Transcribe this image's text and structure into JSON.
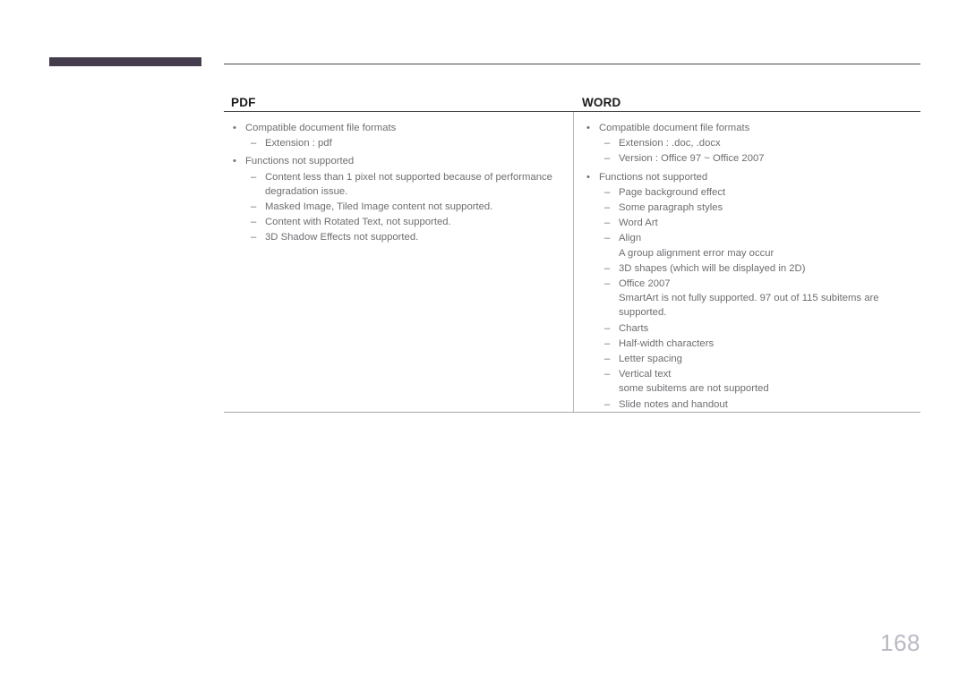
{
  "page": {
    "number": "168"
  },
  "columns": [
    {
      "header": "PDF",
      "items": [
        {
          "level": 1,
          "marker": "•",
          "text": "Compatible document file formats"
        },
        {
          "level": 2,
          "marker": "–",
          "text": "Extension : pdf"
        },
        {
          "level": 1,
          "marker": "•",
          "text": "Functions not supported"
        },
        {
          "level": 2,
          "marker": "–",
          "text": "Content less than 1 pixel not supported because of performance degradation issue."
        },
        {
          "level": 2,
          "marker": "–",
          "text": "Masked Image, Tiled Image content not supported."
        },
        {
          "level": 2,
          "marker": "–",
          "text": "Content with Rotated Text, not supported."
        },
        {
          "level": 2,
          "marker": "–",
          "text": "3D Shadow Effects not supported."
        }
      ]
    },
    {
      "header": "WORD",
      "items": [
        {
          "level": 1,
          "marker": "•",
          "text": "Compatible document file formats"
        },
        {
          "level": 2,
          "marker": "–",
          "text": "Extension : .doc, .docx"
        },
        {
          "level": 2,
          "marker": "–",
          "text": "Version : Office 97 ~ Office 2007"
        },
        {
          "level": 1,
          "marker": "•",
          "text": "Functions not supported"
        },
        {
          "level": 2,
          "marker": "–",
          "text": "Page background effect"
        },
        {
          "level": 2,
          "marker": "–",
          "text": "Some paragraph styles"
        },
        {
          "level": 2,
          "marker": "–",
          "text": "Word Art"
        },
        {
          "level": 2,
          "marker": "–",
          "text": "Align"
        },
        {
          "level": 3,
          "marker": "",
          "text": "A group alignment error may occur"
        },
        {
          "level": 2,
          "marker": "–",
          "text": "3D shapes (which will be displayed in 2D)"
        },
        {
          "level": 2,
          "marker": "–",
          "text": "Office 2007"
        },
        {
          "level": 3,
          "marker": "",
          "text": "SmartArt is not fully supported. 97 out of 115 subitems are supported."
        },
        {
          "level": 2,
          "marker": "–",
          "text": "Charts"
        },
        {
          "level": 2,
          "marker": "–",
          "text": "Half-width characters"
        },
        {
          "level": 2,
          "marker": "–",
          "text": "Letter spacing"
        },
        {
          "level": 2,
          "marker": "–",
          "text": "Vertical text"
        },
        {
          "level": 3,
          "marker": "",
          "text": "some subitems are not supported"
        },
        {
          "level": 2,
          "marker": "–",
          "text": "Slide notes and handout"
        }
      ]
    }
  ],
  "colors": {
    "accent_bar": "#453d4e",
    "body_text": "#6e6e72",
    "header_text": "#1a1a1a",
    "page_number": "#b9b9c4"
  }
}
